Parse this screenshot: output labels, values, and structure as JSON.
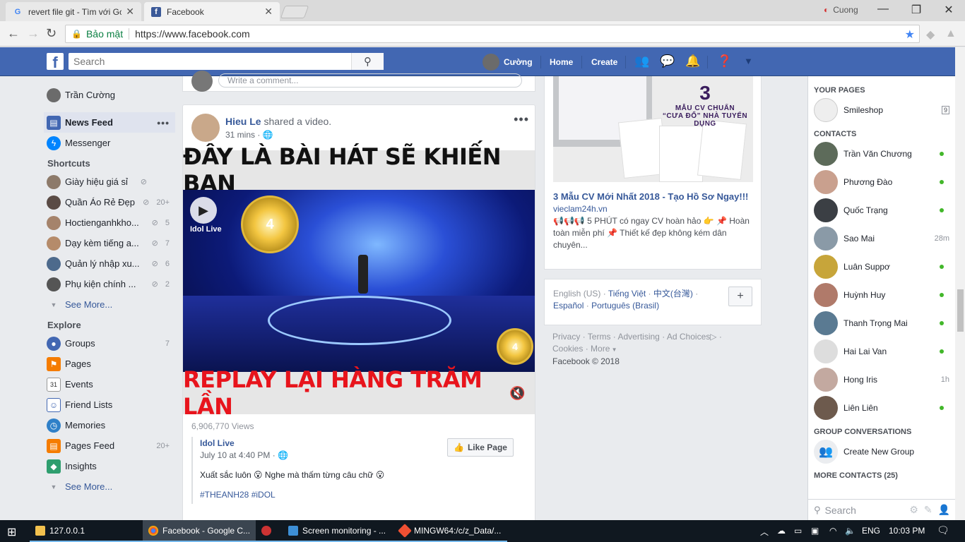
{
  "browser": {
    "tabs": [
      {
        "title": "revert file git - Tìm với Gc",
        "favicon": "google-icon"
      },
      {
        "title": "Facebook",
        "favicon": "facebook-icon"
      }
    ],
    "profile_name": "Cuong",
    "secure_label": "Bảo mật",
    "url": "https://www.facebook.com"
  },
  "fb_header": {
    "search_placeholder": "Search",
    "user_name": "Cường",
    "home": "Home",
    "create": "Create"
  },
  "left_nav": {
    "profile": "Trần Cường",
    "news_feed": "News Feed",
    "messenger": "Messenger",
    "shortcuts_title": "Shortcuts",
    "shortcuts": [
      {
        "label": "Giày hiệu giá sỉ",
        "count": ""
      },
      {
        "label": "Quần Áo Rẻ Đẹp",
        "count": "20+"
      },
      {
        "label": "Hoctienganhkho...",
        "count": "5"
      },
      {
        "label": "Dạy kèm tiếng a...",
        "count": "7"
      },
      {
        "label": "Quản lý nhập xu...",
        "count": "6"
      },
      {
        "label": "Phụ kiện chính ...",
        "count": "2"
      }
    ],
    "see_more": "See More...",
    "explore_title": "Explore",
    "explore": [
      {
        "label": "Groups",
        "count": "7"
      },
      {
        "label": "Pages",
        "count": ""
      },
      {
        "label": "Events",
        "count": ""
      },
      {
        "label": "Friend Lists",
        "count": ""
      },
      {
        "label": "Memories",
        "count": ""
      },
      {
        "label": "Pages Feed",
        "count": "20+"
      },
      {
        "label": "Insights",
        "count": ""
      }
    ],
    "see_more_2": "See More..."
  },
  "feed": {
    "comment_placeholder": "Write a comment...",
    "post": {
      "author": "Hieu Le",
      "action": "shared a video.",
      "time": "31 mins",
      "video_top_text": "ĐÂY LÀ BÀI HÁT SẼ KHIẾN BẠN",
      "video_bottom_text": "REPLAY LẠI HÀNG TRĂM LẦN",
      "video_logo": "Idol Live",
      "views": "6,906,770 Views",
      "shared_page": "Idol Live",
      "shared_time": "July 10 at 4:40 PM",
      "shared_text": "Xuất sắc luôn 😮 Nghe mà thấm từng câu chữ 😮",
      "hashtags": "#THEANH28 #iDOL",
      "like_page": "Like Page"
    }
  },
  "right_col": {
    "ad": {
      "badge_number": "3",
      "badge_line1": "MẪU CV CHUẨN",
      "badge_line2": "“CƯA ĐỔ” NHÀ TUYỂN DỤNG",
      "title": "3 Mẫu CV Mới Nhất 2018 - Tạo Hồ Sơ Ngay!!!",
      "domain": "vieclam24h.vn",
      "desc": "📢📢📢 5 PHÚT có ngay CV hoàn hảo 👉 📌 Hoàn toàn miễn phí 📌 Thiết kế đẹp không kém dân chuyên..."
    },
    "languages": {
      "current": "English (US)",
      "others": [
        "Tiếng Việt",
        "中文(台灣)",
        "Español",
        "Português (Brasil)"
      ],
      "plus": "+"
    },
    "footer_links": [
      "Privacy",
      "Terms",
      "Advertising",
      "Ad Choices",
      "Cookies",
      "More"
    ],
    "copyright": "Facebook © 2018"
  },
  "chat": {
    "your_pages_title": "YOUR PAGES",
    "page_name": "Smileshop",
    "page_badge": "9",
    "contacts_title": "CONTACTS",
    "contacts": [
      {
        "name": "Trần Văn Chương",
        "status": "online",
        "ago": ""
      },
      {
        "name": "Phương Đào",
        "status": "online",
        "ago": ""
      },
      {
        "name": "Quốc Trạng",
        "status": "online",
        "ago": ""
      },
      {
        "name": "Sao Mai",
        "status": "away",
        "ago": "28m"
      },
      {
        "name": "Luân Suppơ",
        "status": "online",
        "ago": ""
      },
      {
        "name": "Huỳnh Huy",
        "status": "online",
        "ago": ""
      },
      {
        "name": "Thanh Trọng Mai",
        "status": "online",
        "ago": ""
      },
      {
        "name": "Hai Lai Van",
        "status": "online",
        "ago": ""
      },
      {
        "name": "Hong Iris",
        "status": "away",
        "ago": "1h"
      },
      {
        "name": "Liên Liên",
        "status": "online",
        "ago": ""
      }
    ],
    "group_title": "GROUP CONVERSATIONS",
    "create_group": "Create New Group",
    "more_contacts": "MORE CONTACTS (25)",
    "search_placeholder": "Search"
  },
  "taskbar": {
    "items": [
      {
        "label": "127.0.0.1",
        "active": false
      },
      {
        "label": "Facebook - Google C...",
        "active": true
      },
      {
        "label": "",
        "active": false
      },
      {
        "label": "Screen monitoring - ...",
        "active": false
      },
      {
        "label": "MINGW64:/c/z_Data/...",
        "active": false
      }
    ],
    "lang": "ENG",
    "time": "10:03 PM"
  },
  "colors": {
    "fb_blue": "#4267b2",
    "link": "#365899",
    "online": "#42b72a"
  }
}
